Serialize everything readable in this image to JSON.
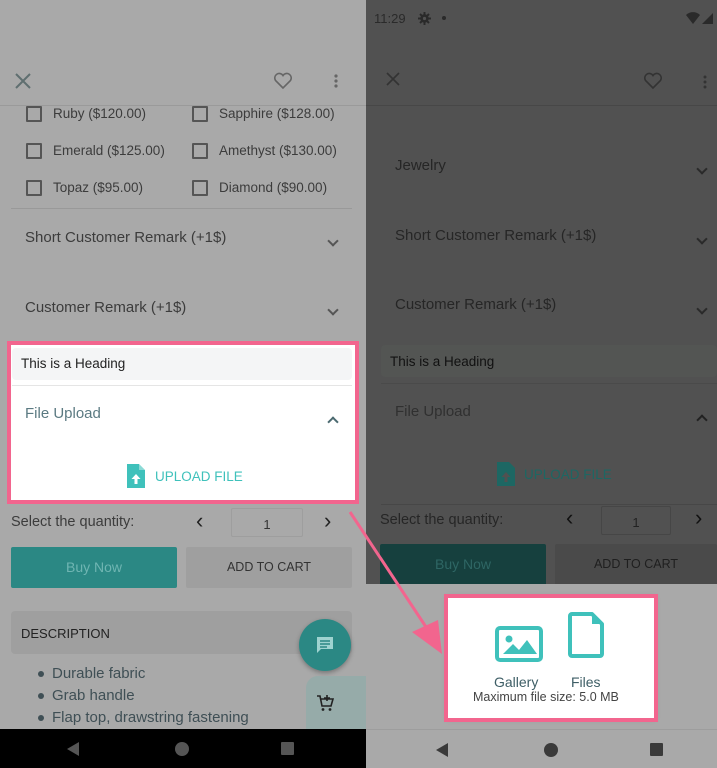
{
  "left": {
    "toolbar": {
      "close_icon": "close-icon",
      "favorite_icon": "heart-outline-icon",
      "menu_icon": "more-vert-icon"
    },
    "options": [
      {
        "label": "Ruby ($120.00)",
        "checked": false
      },
      {
        "label": "Sapphire ($128.00)",
        "checked": false
      },
      {
        "label": "Emerald ($125.00)",
        "checked": false
      },
      {
        "label": "Amethyst ($130.00)",
        "checked": false
      },
      {
        "label": "Topaz ($95.00)",
        "checked": false
      },
      {
        "label": "Diamond ($90.00)",
        "checked": false
      }
    ],
    "sections": [
      {
        "label": "Short Customer Remark (+1$)"
      },
      {
        "label": "Customer Remark (+1$)"
      }
    ],
    "heading": "This is a Heading",
    "file_upload": {
      "label": "File Upload",
      "button": "UPLOAD FILE"
    },
    "quantity": {
      "label": "Select the quantity:",
      "value": "1",
      "prev": "‹",
      "next": "›"
    },
    "buy_now": "Buy Now",
    "add_to_cart": "ADD TO CART",
    "description": {
      "title": "DESCRIPTION",
      "bullets": [
        "Durable fabric",
        "Grab handle",
        "Flap top, drawstring fastening"
      ]
    }
  },
  "right": {
    "status": {
      "time": "11:29"
    },
    "sections": [
      {
        "label": "Jewelry"
      },
      {
        "label": "Short Customer Remark (+1$)"
      },
      {
        "label": "Customer Remark (+1$)"
      }
    ],
    "heading": "This is a Heading",
    "file_upload": {
      "label": "File Upload",
      "button": "UPLOAD FILE"
    },
    "quantity": {
      "label": "Select the quantity:",
      "value": "1"
    },
    "buy_now": "Buy Now",
    "add_to_cart": "ADD TO CART",
    "sheet": {
      "gallery": "Gallery",
      "files": "Files",
      "max_size": "Maximum file size: 5.0 MB"
    }
  },
  "colors": {
    "accent": "#3fc1bb",
    "highlight": "#f2658e",
    "teal_dark": "#2b8884"
  }
}
